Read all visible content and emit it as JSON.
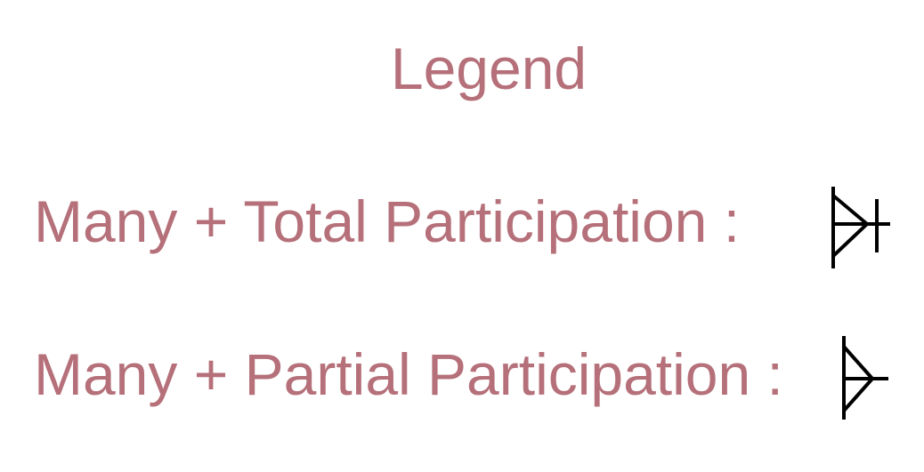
{
  "legend": {
    "title": "Legend",
    "items": [
      {
        "label": "Many + Total Participation :",
        "icon": "crows-foot-many-total-icon"
      },
      {
        "label": "Many + Partial Participation :",
        "icon": "crows-foot-many-partial-icon"
      }
    ],
    "colors": {
      "text": "#b5707a",
      "symbol": "#000000"
    }
  }
}
